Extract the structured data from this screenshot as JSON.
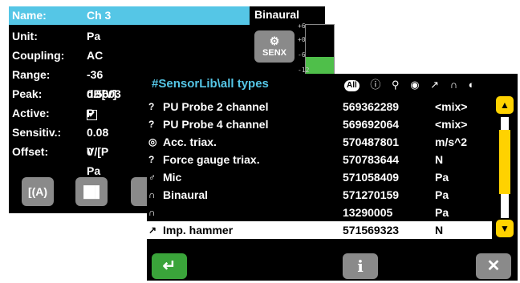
{
  "colors": {
    "accent": "#55c6e6",
    "highlight": "#ffd200",
    "ok": "#4fbf4a",
    "button": "#8a8a8a"
  },
  "channel": {
    "header_label": "Name:",
    "header_value": "Ch 3",
    "mode": "Binaural",
    "rows": [
      {
        "label": "Unit:",
        "value": "Pa"
      },
      {
        "label": "Coupling:",
        "value": "AC"
      },
      {
        "label": "Range:",
        "value": "-36 dB[V]"
      },
      {
        "label": "Peak:",
        "value": "0.5603 P"
      },
      {
        "label": "Active:",
        "value": "✔"
      },
      {
        "label": "Sensitiv.:",
        "value": "0.08 V/[P"
      },
      {
        "label": "Offset:",
        "value": "0 Pa"
      }
    ],
    "senx_label": "SENX",
    "level_fraction": 0.5,
    "scale_ticks": [
      "+6",
      "+0",
      "-6",
      "-12"
    ],
    "bottom_buttons": [
      {
        "label": "[(A)",
        "icon": "weighting-icon"
      },
      {
        "label": "▐█▌",
        "icon": "spectrum-icon"
      }
    ]
  },
  "sensor_lib": {
    "title": "#SensorLib\\all types",
    "filter_all": "All",
    "filter_icons": [
      "?",
      "mic",
      "triax",
      "hammer",
      "binaural",
      "pu"
    ],
    "items": [
      {
        "icon": "?",
        "name": "PU Probe  2  channel",
        "id": "569362289",
        "unit": "<mix>"
      },
      {
        "icon": "?",
        "name": "PU Probe 4 channel",
        "id": "569692064",
        "unit": "<mix>"
      },
      {
        "icon": "◎",
        "name": "Acc. triax.",
        "id": "570487801",
        "unit": "m/s^2"
      },
      {
        "icon": "?",
        "name": "Force gauge triax.",
        "id": "570783644",
        "unit": "N"
      },
      {
        "icon": "♂",
        "name": "Mic",
        "id": "571058409",
        "unit": "Pa"
      },
      {
        "icon": "∩",
        "name": "Binaural",
        "id": "571270159",
        "unit": "Pa"
      },
      {
        "icon": "∩",
        "name": "",
        "id": "13290005",
        "unit": "Pa"
      },
      {
        "icon": "↗",
        "name": "Imp. hammer",
        "id": "571569323",
        "unit": "N"
      }
    ],
    "selected_index": 7,
    "scroll_position": 0.35,
    "footer": {
      "ok": "↵",
      "info": "i",
      "close": "✕"
    }
  }
}
